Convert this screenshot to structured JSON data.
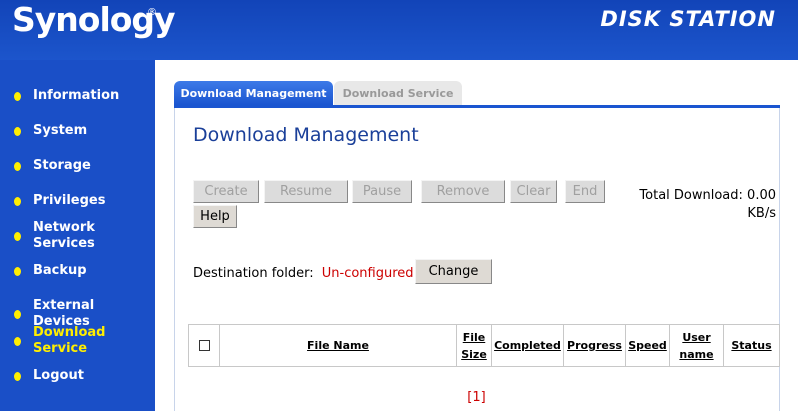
{
  "header": {
    "logo": "Synology",
    "registered_mark": "®",
    "product_title": "DISK STATION"
  },
  "sidebar": {
    "items": [
      {
        "label": "Information"
      },
      {
        "label": "System"
      },
      {
        "label": "Storage"
      },
      {
        "label": "Privileges"
      },
      {
        "label": "Network Services"
      },
      {
        "label": "Backup"
      },
      {
        "label": "External Devices"
      },
      {
        "label": "Download Service",
        "active": true
      },
      {
        "label": "Logout"
      }
    ]
  },
  "tabs": [
    {
      "label": "Download Management",
      "active": true
    },
    {
      "label": "Download Service",
      "active": false
    }
  ],
  "main": {
    "title": "Download Management",
    "toolbar": {
      "create": "Create",
      "resume": "Resume",
      "pause": "Pause",
      "remove": "Remove",
      "clear": "Clear",
      "end": "End",
      "help": "Help"
    },
    "total_download_label": "Total Download:",
    "total_download_value": "0.00",
    "total_download_unit": "KB/s",
    "destination_label": "Destination folder:",
    "destination_value": "Un-configured",
    "change_button": "Change",
    "table": {
      "columns": [
        "File Name",
        "File Size",
        "Completed",
        "Progress",
        "Speed",
        "User name",
        "Status"
      ]
    },
    "pager": "[1]"
  },
  "colors": {
    "sidebar_bg": "#1a4fc7",
    "accent_yellow": "#ffee00",
    "title_blue": "#1a3f99",
    "warning_red": "#cc0000"
  }
}
